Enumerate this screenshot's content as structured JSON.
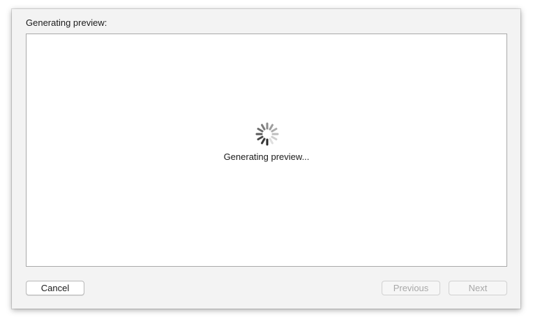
{
  "dialog": {
    "header_label": "Generating preview:",
    "status_text": "Generating preview...",
    "spinner_icon": "activity-spinner-icon"
  },
  "buttons": {
    "cancel_label": "Cancel",
    "previous_label": "Previous",
    "next_label": "Next"
  }
}
